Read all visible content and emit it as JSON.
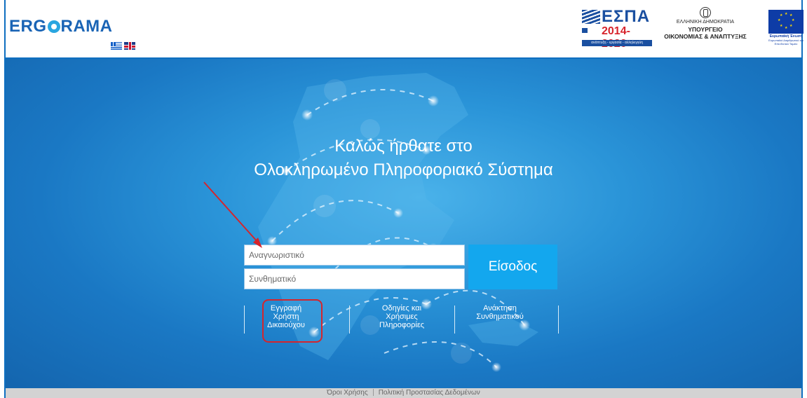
{
  "header": {
    "logo_text": "ERGORAMA",
    "logo_left": "ERG",
    "logo_right": "RAMA",
    "espa": {
      "title": "ΕΣΠΑ",
      "years": "2014-2020",
      "tagline": "ανάπτυξη - εργασία - αλληλεγγύη"
    },
    "ministry": {
      "line1": "ΕΛΛΗΝΙΚΗ ΔΗΜΟΚΡΑΤΙΑ",
      "line2": "ΥΠΟΥΡΓΕΙΟ",
      "line3": "ΟΙΚΟΝΟΜΙΑΣ & ΑΝΑΠΤΥΞΗΣ"
    },
    "eu": {
      "line1": "Ευρωπαϊκή Ένωση",
      "line2": "Ευρωπαϊκό Διαρθρωτικό και Επενδυτικό Ταμείο"
    },
    "languages": [
      "greek-flag-icon",
      "uk-flag-icon"
    ]
  },
  "hero": {
    "welcome_line1": "Καλώς ήρθατε στο",
    "welcome_line2": "Ολοκληρωμένο Πληροφοριακό Σύστημα"
  },
  "login": {
    "username_placeholder": "Αναγνωριστικό",
    "password_placeholder": "Συνθηματικό",
    "submit_label": "Είσοδος"
  },
  "links": {
    "register": "Εγγραφή\nΧρήστη\nΔικαιούχου",
    "guides": "Οδηγίες και\nΧρήσιμες\nΠληροφορίες",
    "recover": "Ανάκτηση\nΣυνθηματικού"
  },
  "footer": {
    "terms": "Όροι Χρήσης",
    "privacy": "Πολιτική Προστασίας Δεδομένων"
  },
  "colors": {
    "brand": "#1a64b5",
    "hero_blue": "#2a94d8",
    "submit_button": "#13a7ee",
    "annotation_red": "#d5252c"
  }
}
